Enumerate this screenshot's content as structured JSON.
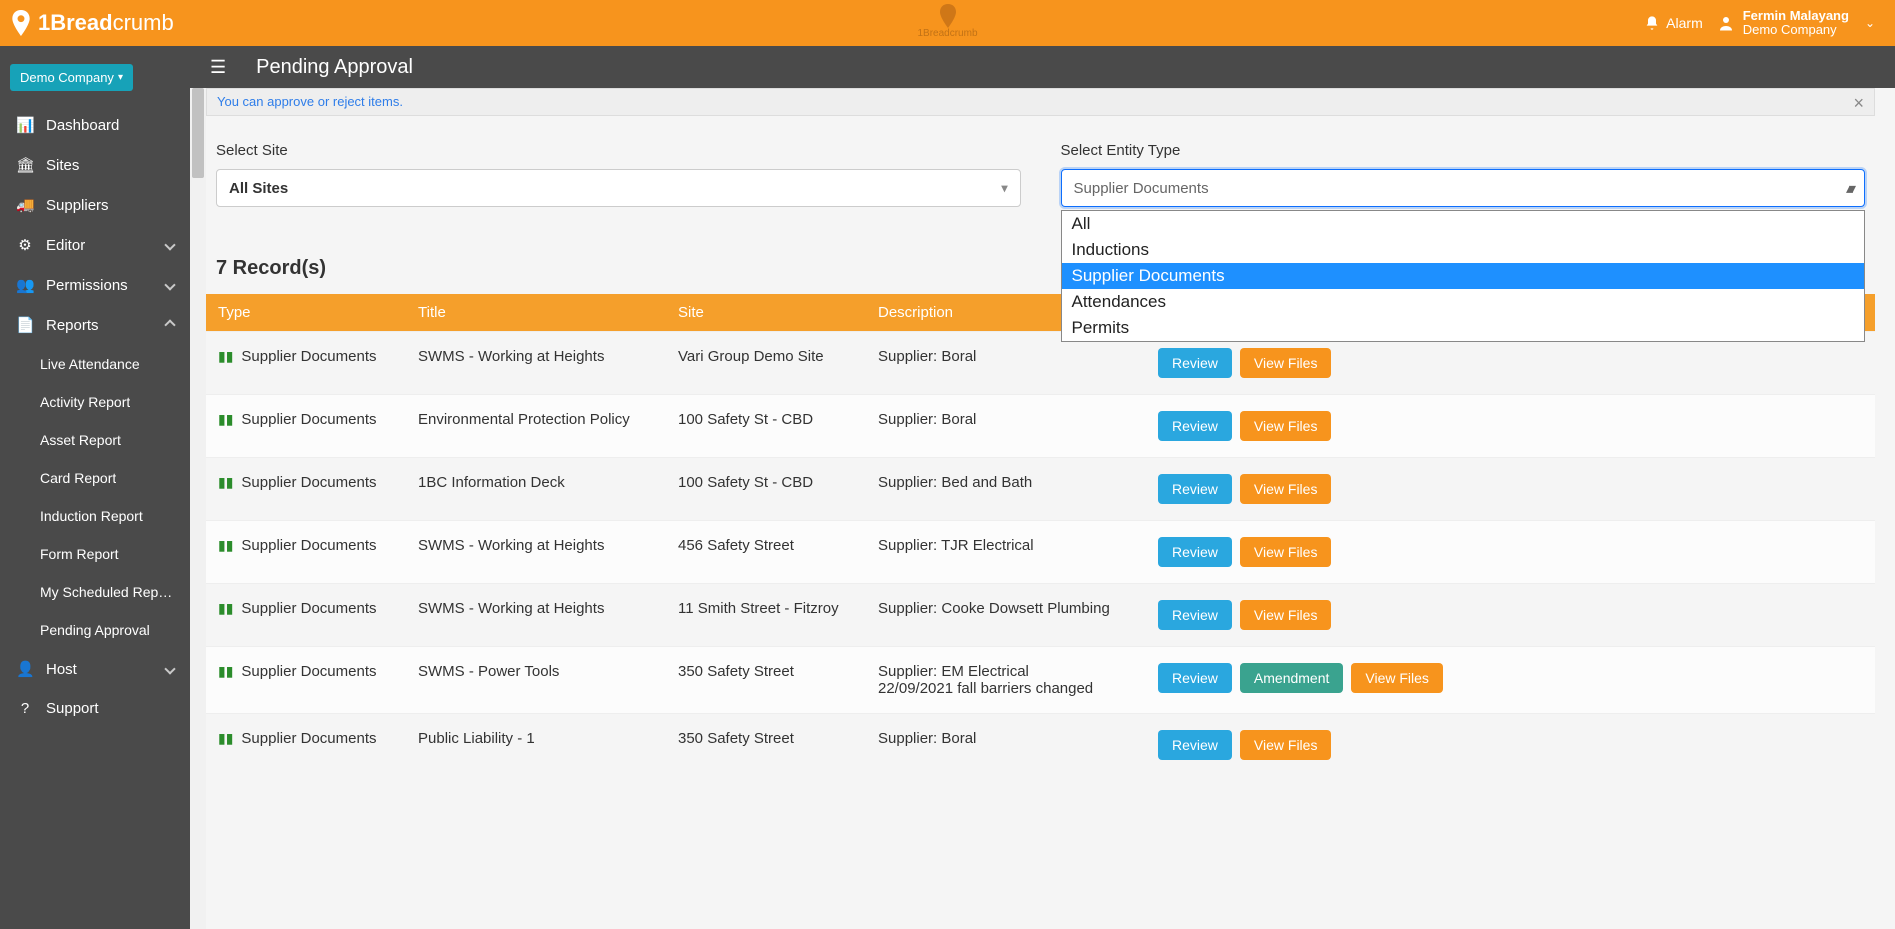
{
  "brand": {
    "name_bold": "1Bread",
    "name_light": "crumb",
    "mini": "1Breadcrumb"
  },
  "topbar": {
    "alarm": "Alarm",
    "user_name": "Fermin Malayang",
    "user_company": "Demo Company"
  },
  "subbar": {
    "title": "Pending Approval"
  },
  "sidebar": {
    "company_chip": "Demo Company",
    "items": [
      {
        "icon": "chart",
        "label": "Dashboard",
        "sub": false
      },
      {
        "icon": "site",
        "label": "Sites",
        "sub": false
      },
      {
        "icon": "truck",
        "label": "Suppliers",
        "sub": false
      },
      {
        "icon": "gear",
        "label": "Editor",
        "sub": false,
        "expandable": true
      },
      {
        "icon": "users",
        "label": "Permissions",
        "sub": false,
        "expandable": true
      },
      {
        "icon": "list",
        "label": "Reports",
        "sub": false,
        "expandable": true,
        "expanded": true
      },
      {
        "icon": "",
        "label": "Live Attendance",
        "sub": true
      },
      {
        "icon": "",
        "label": "Activity Report",
        "sub": true
      },
      {
        "icon": "",
        "label": "Asset Report",
        "sub": true
      },
      {
        "icon": "",
        "label": "Card Report",
        "sub": true
      },
      {
        "icon": "",
        "label": "Induction Report",
        "sub": true
      },
      {
        "icon": "",
        "label": "Form Report",
        "sub": true
      },
      {
        "icon": "",
        "label": "My Scheduled Repo...",
        "sub": true
      },
      {
        "icon": "",
        "label": "Pending Approval",
        "sub": true
      },
      {
        "icon": "userplus",
        "label": "Host",
        "sub": false,
        "expandable": true
      },
      {
        "icon": "question",
        "label": "Support",
        "sub": false
      }
    ]
  },
  "banner": {
    "text": "You can approve or reject items."
  },
  "filters": {
    "site": {
      "label": "Select Site",
      "value": "All Sites"
    },
    "entity": {
      "label": "Select Entity Type",
      "value": "Supplier Documents",
      "options": [
        "All",
        "Inductions",
        "Supplier Documents",
        "Attendances",
        "Permits"
      ],
      "selected_index": 2
    }
  },
  "records": {
    "count_text": "7 Record(s)"
  },
  "columns": {
    "type": "Type",
    "title": "Title",
    "site": "Site",
    "description": "Description"
  },
  "buttons": {
    "review": "Review",
    "view_files": "View Files",
    "amendment": "Amendment"
  },
  "rows": [
    {
      "type": "Supplier Documents",
      "title": "SWMS - Working at Heights",
      "site": "Vari Group Demo Site",
      "description": "Supplier: Boral",
      "amend": false
    },
    {
      "type": "Supplier Documents",
      "title": "Environmental Protection Policy",
      "site": "100 Safety St - CBD",
      "description": "Supplier: Boral",
      "amend": false
    },
    {
      "type": "Supplier Documents",
      "title": "1BC Information Deck",
      "site": "100 Safety St - CBD",
      "description": "Supplier: Bed and Bath",
      "amend": false
    },
    {
      "type": "Supplier Documents",
      "title": "SWMS - Working at Heights",
      "site": "456 Safety Street",
      "description": "Supplier: TJR Electrical",
      "amend": false
    },
    {
      "type": "Supplier Documents",
      "title": "SWMS - Working at Heights",
      "site": "11 Smith Street - Fitzroy",
      "description": "Supplier: Cooke Dowsett Plumbing",
      "amend": false
    },
    {
      "type": "Supplier Documents",
      "title": "SWMS - Power Tools",
      "site": "350 Safety Street",
      "description": "Supplier: EM Electrical\n22/09/2021 fall barriers changed",
      "amend": true
    },
    {
      "type": "Supplier Documents",
      "title": "Public Liability - 1",
      "site": "350 Safety Street",
      "description": "Supplier: Boral",
      "amend": false
    }
  ]
}
